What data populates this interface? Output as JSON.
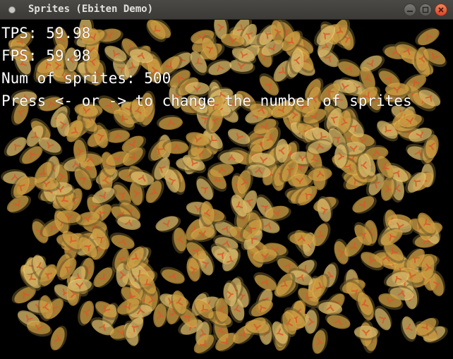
{
  "window": {
    "title": "Sprites (Ebiten Demo)",
    "buttons": [
      {
        "name": "minimize",
        "icon": "minimize-icon"
      },
      {
        "name": "maximize",
        "icon": "maximize-icon"
      },
      {
        "name": "close",
        "icon": "close-icon"
      }
    ]
  },
  "hud": {
    "tps": "TPS: 59.98",
    "fps": "FPS: 59.98",
    "sprites": "Num of sprites: 500",
    "hint": "Press <- or -> to change the number of sprites"
  },
  "game": {
    "sprite_count": 500,
    "colors": {
      "background": "#000000",
      "sprite_body": "#e8b04a",
      "sprite_shadow": "#6b5a2a",
      "sprite_highlight": "#f5d27a",
      "sprite_accent": "#d9582a"
    }
  }
}
